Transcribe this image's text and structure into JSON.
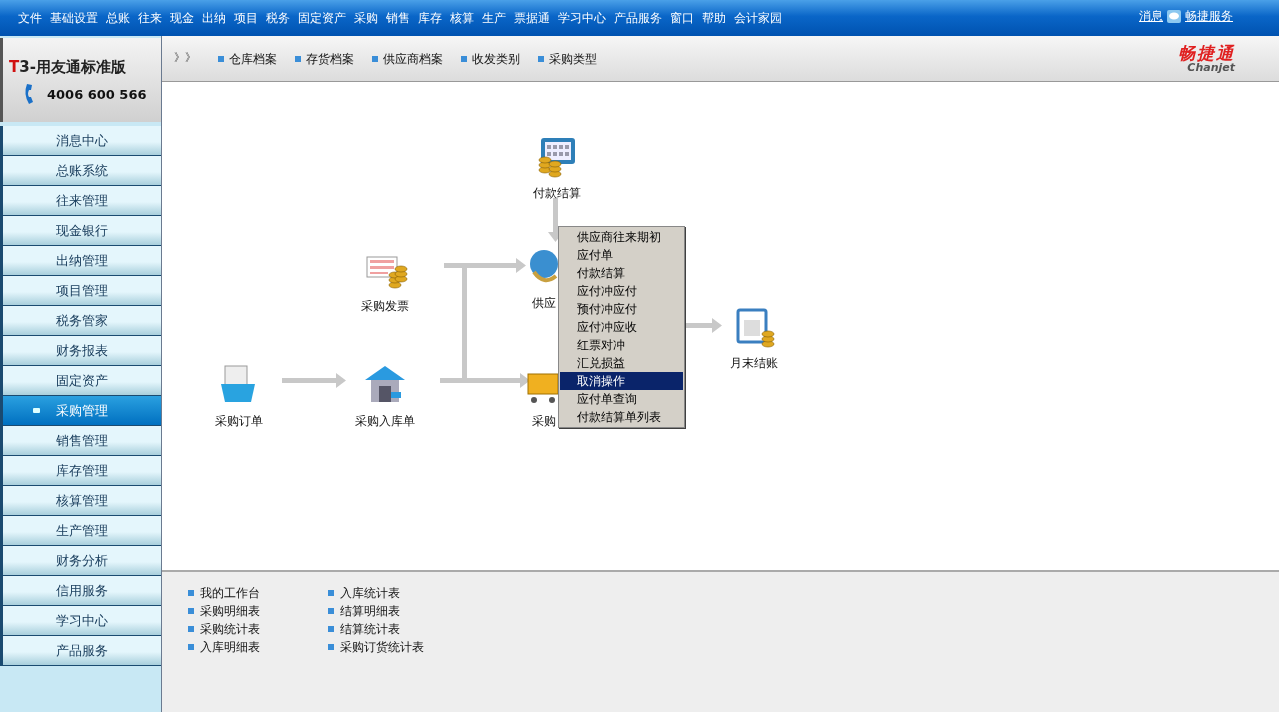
{
  "menu_bar": {
    "items": [
      "文件",
      "基础设置",
      "总账",
      "往来",
      "现金",
      "出纳",
      "项目",
      "税务",
      "固定资产",
      "采购",
      "销售",
      "库存",
      "核算",
      "生产",
      "票据通",
      "学习中心",
      "产品服务",
      "窗口",
      "帮助",
      "会计家园"
    ],
    "links": [
      "消息",
      "畅捷服务"
    ]
  },
  "brand": {
    "mark": "T",
    "name": "3-用友通标准版",
    "phone": "4006 600 566"
  },
  "sidebar": {
    "items": [
      {
        "label": "消息中心",
        "selected": false
      },
      {
        "label": "总账系统",
        "selected": false
      },
      {
        "label": "往来管理",
        "selected": false
      },
      {
        "label": "现金银行",
        "selected": false
      },
      {
        "label": "出纳管理",
        "selected": false
      },
      {
        "label": "项目管理",
        "selected": false
      },
      {
        "label": "税务管家",
        "selected": false
      },
      {
        "label": "财务报表",
        "selected": false
      },
      {
        "label": "固定资产",
        "selected": false
      },
      {
        "label": "采购管理",
        "selected": true
      },
      {
        "label": "销售管理",
        "selected": false
      },
      {
        "label": "库存管理",
        "selected": false
      },
      {
        "label": "核算管理",
        "selected": false
      },
      {
        "label": "生产管理",
        "selected": false
      },
      {
        "label": "财务分析",
        "selected": false
      },
      {
        "label": "信用服务",
        "selected": false
      },
      {
        "label": "学习中心",
        "selected": false
      },
      {
        "label": "产品服务",
        "selected": false
      }
    ]
  },
  "toolbar": {
    "arrows": "》》",
    "links": [
      "仓库档案",
      "存货档案",
      "供应商档案",
      "收发类别",
      "采购类型"
    ]
  },
  "vendor_logo": {
    "name": "畅捷通",
    "latin": "Chanjet"
  },
  "flow": {
    "nodes": [
      {
        "label": "付款结算"
      },
      {
        "label": "采购发票"
      },
      {
        "label": "供应"
      },
      {
        "label": "月末结账"
      },
      {
        "label": "采购订单"
      },
      {
        "label": "采购入库单"
      },
      {
        "label": "采购"
      }
    ]
  },
  "context_menu": {
    "items": [
      {
        "label": "供应商往来期初",
        "selected": false
      },
      {
        "label": "应付单",
        "selected": false
      },
      {
        "label": "付款结算",
        "selected": false
      },
      {
        "label": "应付冲应付",
        "selected": false
      },
      {
        "label": "预付冲应付",
        "selected": false
      },
      {
        "label": "应付冲应收",
        "selected": false
      },
      {
        "label": "红票对冲",
        "selected": false
      },
      {
        "label": "汇兑损益",
        "selected": false
      },
      {
        "label": "取消操作",
        "selected": true
      },
      {
        "label": "应付单查询",
        "selected": false
      },
      {
        "label": "付款结算单列表",
        "selected": false
      }
    ]
  },
  "reports": {
    "columns": [
      [
        "我的工作台",
        "采购明细表",
        "采购统计表",
        "入库明细表"
      ],
      [
        "入库统计表",
        "结算明细表",
        "结算统计表",
        "采购订货统计表"
      ]
    ]
  }
}
